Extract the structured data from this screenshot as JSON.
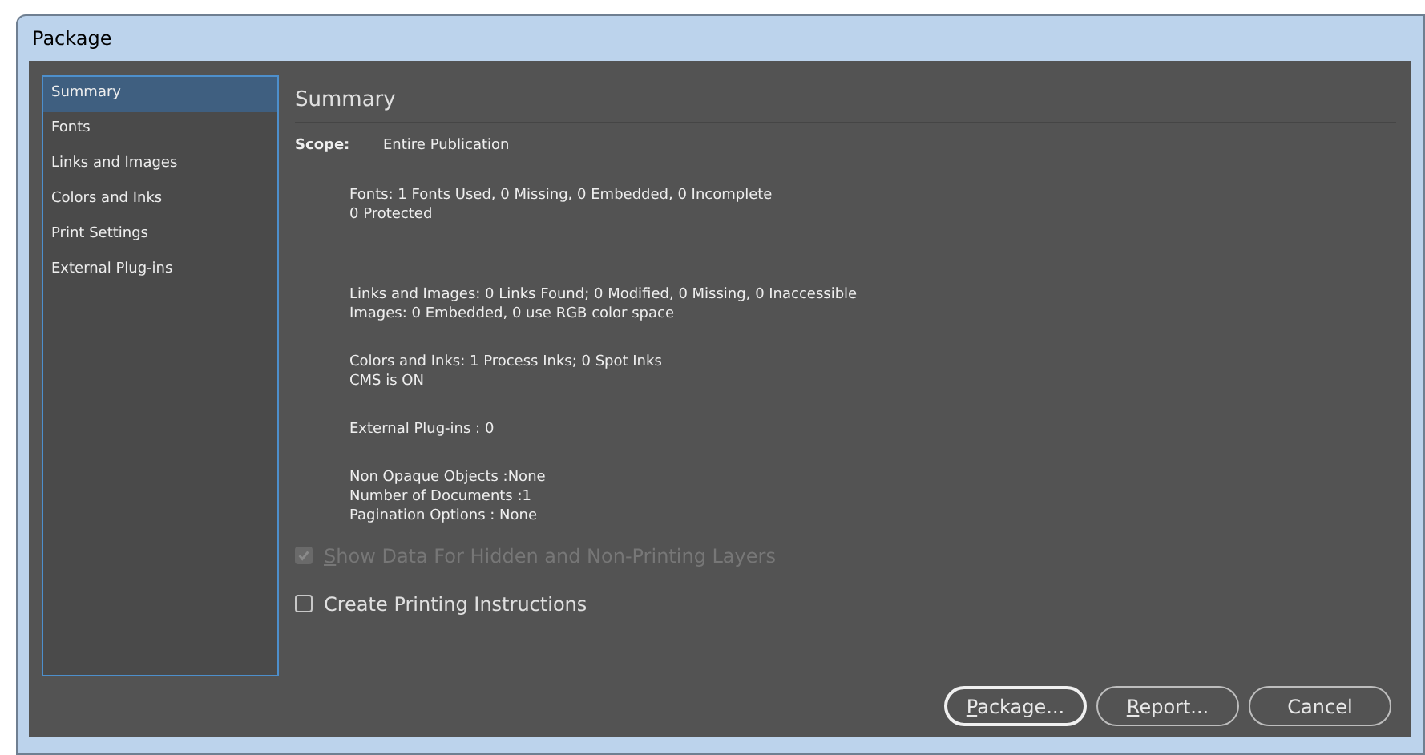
{
  "window": {
    "title": "Package"
  },
  "sidebar": {
    "items": [
      {
        "label": "Summary",
        "selected": true
      },
      {
        "label": "Fonts",
        "selected": false
      },
      {
        "label": "Links and Images",
        "selected": false
      },
      {
        "label": "Colors and Inks",
        "selected": false
      },
      {
        "label": "Print Settings",
        "selected": false
      },
      {
        "label": "External Plug-ins",
        "selected": false
      }
    ]
  },
  "heading": "Summary",
  "scope": {
    "label": "Scope:",
    "value": "Entire Publication"
  },
  "sections": [
    {
      "lines": [
        "Fonts: 1 Fonts Used, 0 Missing, 0 Embedded, 0 Incomplete",
        "0 Protected"
      ]
    },
    {
      "lines": [
        "Links and Images: 0 Links Found; 0 Modified, 0 Missing, 0 Inaccessible",
        "Images: 0 Embedded, 0 use RGB color space"
      ]
    },
    {
      "lines": [
        "Colors and Inks: 1 Process Inks; 0 Spot Inks",
        "CMS is ON"
      ]
    },
    {
      "lines": [
        "External Plug-ins : 0"
      ]
    },
    {
      "lines": [
        "Non Opaque Objects :None",
        "Number of Documents :1",
        "Pagination Options : None"
      ]
    }
  ],
  "options": [
    {
      "label": "Show Data For Hidden and Non-Printing Layers",
      "checked": true,
      "disabled": true,
      "mnemonic": true
    },
    {
      "label": "Create Printing Instructions",
      "checked": false,
      "disabled": false,
      "mnemonic": false
    }
  ],
  "buttons": [
    {
      "label": "Package...",
      "default": true,
      "mnemonic": true
    },
    {
      "label": "Report...",
      "default": false,
      "mnemonic": true
    },
    {
      "label": "Cancel",
      "default": false,
      "mnemonic": false
    }
  ]
}
